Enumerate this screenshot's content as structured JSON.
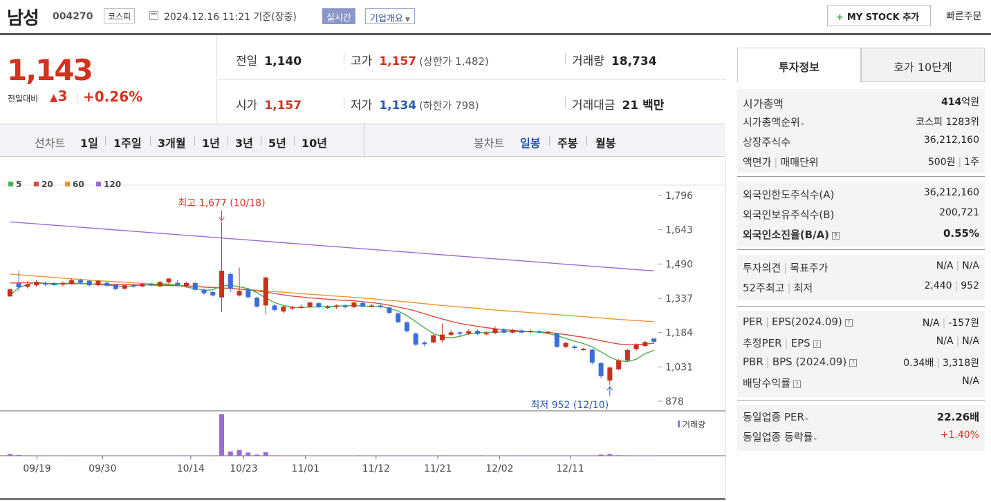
{
  "header": {
    "name": "남성",
    "code": "004270",
    "market": "코스피",
    "datetime": "2024.12.16 11:21  기준(장중)",
    "realtime": "실시간",
    "corp_overview": "기업개요",
    "mystock": "MY STOCK 추가",
    "mystock_plus": "+",
    "quick_order": "빠른주문"
  },
  "price": {
    "current": "1,143",
    "change_label": "전일대비",
    "change_arrow": "▲",
    "change": "3",
    "change_pct": "+0.26%"
  },
  "stats": {
    "prev_label": "전일",
    "prev": "1,140",
    "high_label": "고가",
    "high": "1,157",
    "upper_limit": "(상한가 1,482)",
    "volume_label": "거래량",
    "volume": "18,734",
    "open_label": "시가",
    "open": "1,157",
    "low_label": "저가",
    "low": "1,134",
    "lower_limit": "(하한가 798)",
    "amount_label": "거래대금",
    "amount": "21 백만"
  },
  "period_bar": {
    "line_label": "선차트",
    "line_items": [
      "1일",
      "1주일",
      "3개월",
      "1년",
      "3년",
      "5년",
      "10년"
    ],
    "candle_label": "봉차트",
    "candle_items": [
      "일봉",
      "주봉",
      "월봉"
    ],
    "candle_selected": "일봉"
  },
  "tabs": [
    "투자정보",
    "호가 10단계"
  ],
  "invest": {
    "mcap_label": "시가총액",
    "mcap_num": "414",
    "mcap_unit": "억원",
    "rank_label": "시가총액순위",
    "rank": "코스피 1283위",
    "shares_label": "상장주식수",
    "shares": "36,212,160",
    "par_label1": "액면가",
    "par_label2": "매매단위",
    "par": "500원",
    "unit": "1주",
    "foreign_limit_label": "외국인한도주식수(A)",
    "foreign_limit": "36,212,160",
    "foreign_hold_label": "외국인보유주식수(B)",
    "foreign_hold": "200,721",
    "foreign_ratio_label": "외국인소진율(B/A)",
    "foreign_ratio": "0.55%",
    "opinion_label1": "투자의견",
    "opinion_label2": "목표주가",
    "opinion": "N/A",
    "target": "N/A",
    "w52_label1": "52주최고",
    "w52_label2": "최저",
    "w52_high": "2,440",
    "w52_low": "952",
    "per_label1": "PER",
    "per_label2": "EPS(2024.09)",
    "per": "N/A",
    "eps": "-157원",
    "eper_label1": "추정PER",
    "eper_label2": "EPS",
    "eper": "N/A",
    "eeps": "N/A",
    "pbr_label1": "PBR",
    "pbr_label2": "BPS (2024.09)",
    "pbr": "0.34배",
    "bps": "3,318원",
    "div_label": "배당수익률",
    "div": "N/A",
    "ind_per_label": "동일업종 PER",
    "ind_per": "22.26배",
    "ind_chg_label": "동일업종 등락률",
    "ind_chg": "+1.40%",
    "help": "?"
  },
  "chart_data": {
    "type": "candlestick",
    "legend": [
      {
        "name": "5",
        "color": "#4caf50"
      },
      {
        "name": "20",
        "color": "#d84b3a"
      },
      {
        "name": "60",
        "color": "#f0922a"
      },
      {
        "name": "120",
        "color": "#9c6ad6"
      }
    ],
    "y_ticks": [
      1796,
      1643,
      1490,
      1337,
      1184,
      1031,
      878
    ],
    "ylim": [
      878,
      1796
    ],
    "x_ticks": [
      "09/19",
      "09/30",
      "10/14",
      "10/23",
      "11/01",
      "11/12",
      "11/21",
      "12/02",
      "12/11"
    ],
    "high_annotation": "최고 1,677 (10/18)",
    "low_annotation": "최저 952 (12/10)",
    "volume_label": "거래량",
    "up_color": "#c8321c",
    "down_color": "#3b6fd8",
    "candles": [
      [
        1345,
        1378,
        1345,
        1378
      ],
      [
        1404,
        1386,
        1460,
        1370
      ],
      [
        1388,
        1400,
        1415,
        1380
      ],
      [
        1395,
        1410,
        1420,
        1388
      ],
      [
        1405,
        1398,
        1412,
        1392
      ],
      [
        1402,
        1399,
        1410,
        1393
      ],
      [
        1398,
        1405,
        1412,
        1390
      ],
      [
        1402,
        1418,
        1424,
        1398
      ],
      [
        1418,
        1406,
        1424,
        1400
      ],
      [
        1415,
        1395,
        1420,
        1390
      ],
      [
        1395,
        1415,
        1418,
        1390
      ],
      [
        1406,
        1393,
        1412,
        1388
      ],
      [
        1398,
        1378,
        1402,
        1372
      ],
      [
        1380,
        1395,
        1400,
        1375
      ],
      [
        1396,
        1389,
        1402,
        1384
      ],
      [
        1390,
        1402,
        1408,
        1386
      ],
      [
        1402,
        1395,
        1408,
        1390
      ],
      [
        1390,
        1410,
        1415,
        1386
      ],
      [
        1408,
        1425,
        1428,
        1400
      ],
      [
        1406,
        1395,
        1418,
        1390
      ],
      [
        1392,
        1405,
        1410,
        1386
      ],
      [
        1405,
        1375,
        1410,
        1372
      ],
      [
        1376,
        1360,
        1380,
        1352
      ],
      [
        1365,
        1350,
        1370,
        1345
      ],
      [
        1341,
        1460,
        1677,
        1275
      ],
      [
        1445,
        1380,
        1452,
        1365
      ],
      [
        1350,
        1370,
        1474,
        1345
      ],
      [
        1378,
        1342,
        1385,
        1335
      ],
      [
        1340,
        1300,
        1345,
        1295
      ],
      [
        1305,
        1430,
        1435,
        1265
      ],
      [
        1305,
        1285,
        1312,
        1278
      ],
      [
        1278,
        1300,
        1306,
        1272
      ],
      [
        1292,
        1298,
        1304,
        1285
      ],
      [
        1298,
        1300,
        1310,
        1290
      ],
      [
        1300,
        1318,
        1322,
        1294
      ],
      [
        1315,
        1298,
        1320,
        1292
      ],
      [
        1296,
        1300,
        1306,
        1290
      ],
      [
        1298,
        1305,
        1310,
        1290
      ],
      [
        1304,
        1298,
        1310,
        1292
      ],
      [
        1298,
        1318,
        1322,
        1294
      ],
      [
        1316,
        1300,
        1320,
        1296
      ],
      [
        1300,
        1305,
        1312,
        1298
      ],
      [
        1305,
        1298,
        1310,
        1292
      ],
      [
        1296,
        1272,
        1300,
        1266
      ],
      [
        1270,
        1230,
        1275,
        1226
      ],
      [
        1230,
        1190,
        1236,
        1184
      ],
      [
        1180,
        1130,
        1186,
        1125
      ],
      [
        1140,
        1132,
        1146,
        1122
      ],
      [
        1140,
        1172,
        1176,
        1136
      ],
      [
        1150,
        1175,
        1225,
        1140
      ],
      [
        1174,
        1185,
        1195,
        1168
      ],
      [
        1185,
        1180,
        1190,
        1170
      ],
      [
        1180,
        1190,
        1198,
        1174
      ],
      [
        1192,
        1178,
        1198,
        1172
      ],
      [
        1178,
        1182,
        1190,
        1172
      ],
      [
        1182,
        1200,
        1212,
        1176
      ],
      [
        1198,
        1184,
        1204,
        1178
      ],
      [
        1184,
        1196,
        1202,
        1180
      ],
      [
        1194,
        1184,
        1200,
        1180
      ],
      [
        1186,
        1192,
        1198,
        1180
      ],
      [
        1190,
        1184,
        1196,
        1178
      ],
      [
        1184,
        1188,
        1192,
        1176
      ],
      [
        1180,
        1120,
        1185,
        1116
      ],
      [
        1120,
        1138,
        1143,
        1114
      ],
      [
        1122,
        1115,
        1128,
        1110
      ],
      [
        1110,
        1112,
        1116,
        1104
      ],
      [
        1108,
        1050,
        1112,
        1042
      ],
      [
        1048,
        990,
        1052,
        980
      ],
      [
        970,
        1028,
        1032,
        952
      ],
      [
        1020,
        1060,
        1066,
        1016
      ],
      [
        1060,
        1106,
        1112,
        1055
      ],
      [
        1110,
        1132,
        1136,
        1104
      ],
      [
        1124,
        1142,
        1148,
        1120
      ],
      [
        1158,
        1143,
        1157,
        1134
      ]
    ],
    "ma5": [
      1350,
      1385,
      1398,
      1410,
      1404,
      1398,
      1404,
      1405,
      1403,
      1402,
      1398,
      1396,
      1392,
      1390,
      1392,
      1395,
      1398,
      1402,
      1400,
      1396,
      1387,
      1380,
      1372,
      1375,
      1392,
      1395,
      1388,
      1380,
      1362,
      1338,
      1318,
      1305,
      1297,
      1296,
      1298,
      1299,
      1300,
      1302,
      1304,
      1304,
      1303,
      1300,
      1300,
      1293,
      1280,
      1260,
      1233,
      1205,
      1180,
      1165,
      1160,
      1167,
      1178,
      1183,
      1185,
      1186,
      1187,
      1188,
      1188,
      1188,
      1186,
      1180,
      1170,
      1158,
      1146,
      1135,
      1120,
      1098,
      1075,
      1058,
      1055,
      1065,
      1090,
      1105
    ],
    "ma20": [
      1405,
      1406,
      1406,
      1405,
      1404,
      1403,
      1402,
      1402,
      1402,
      1401,
      1400,
      1400,
      1399,
      1398,
      1397,
      1397,
      1396,
      1395,
      1394,
      1393,
      1392,
      1390,
      1387,
      1385,
      1383,
      1381,
      1378,
      1375,
      1370,
      1365,
      1358,
      1352,
      1347,
      1343,
      1339,
      1336,
      1333,
      1330,
      1328,
      1326,
      1322,
      1318,
      1313,
      1306,
      1298,
      1290,
      1280,
      1268,
      1256,
      1245,
      1234,
      1225,
      1218,
      1212,
      1206,
      1201,
      1197,
      1194,
      1191,
      1189,
      1187,
      1185,
      1180,
      1175,
      1169,
      1163,
      1156,
      1148,
      1140,
      1133,
      1130,
      1130,
      1133,
      1136
    ],
    "ma60": [
      1445,
      1442,
      1439,
      1436,
      1433,
      1430,
      1427,
      1424,
      1421,
      1418,
      1416,
      1413,
      1411,
      1409,
      1406,
      1404,
      1401,
      1399,
      1397,
      1394,
      1392,
      1390,
      1388,
      1385,
      1383,
      1381,
      1378,
      1376,
      1373,
      1370,
      1367,
      1364,
      1361,
      1358,
      1355,
      1352,
      1349,
      1347,
      1344,
      1341,
      1338,
      1335,
      1331,
      1328,
      1325,
      1321,
      1317,
      1313,
      1309,
      1305,
      1302,
      1298,
      1295,
      1292,
      1288,
      1285,
      1282,
      1279,
      1276,
      1273,
      1270,
      1267,
      1264,
      1261,
      1258,
      1255,
      1252,
      1249,
      1246,
      1243,
      1240,
      1238,
      1235,
      1233
    ],
    "ma120": [
      1678,
      1675,
      1672,
      1669,
      1666,
      1663,
      1660,
      1657,
      1654,
      1651,
      1648,
      1645,
      1642,
      1639,
      1636,
      1633,
      1630,
      1627,
      1624,
      1621,
      1618,
      1615,
      1612,
      1609,
      1606,
      1603,
      1600,
      1597,
      1594,
      1591,
      1588,
      1585,
      1582,
      1579,
      1576,
      1573,
      1570,
      1567,
      1564,
      1561,
      1558,
      1555,
      1552,
      1549,
      1546,
      1543,
      1540,
      1537,
      1534,
      1531,
      1528,
      1525,
      1522,
      1519,
      1516,
      1513,
      1510,
      1507,
      1504,
      1501,
      1498,
      1495,
      1492,
      1489,
      1486,
      1483,
      1480,
      1477,
      1474,
      1471,
      1468,
      1465,
      1462,
      1460
    ],
    "volume": [
      12,
      5,
      3,
      2,
      2,
      1,
      1,
      2,
      1,
      1,
      1,
      1,
      1,
      1,
      1,
      1,
      1,
      1,
      1,
      1,
      1,
      1,
      1,
      2,
      290,
      30,
      40,
      22,
      8,
      25,
      3,
      2,
      2,
      2,
      2,
      2,
      2,
      2,
      2,
      2,
      2,
      2,
      2,
      2,
      2,
      2,
      3,
      2,
      2,
      3,
      2,
      2,
      2,
      2,
      2,
      2,
      2,
      2,
      2,
      2,
      2,
      2,
      2,
      2,
      2,
      2,
      3,
      8,
      12,
      4,
      3,
      2,
      2,
      2
    ]
  }
}
